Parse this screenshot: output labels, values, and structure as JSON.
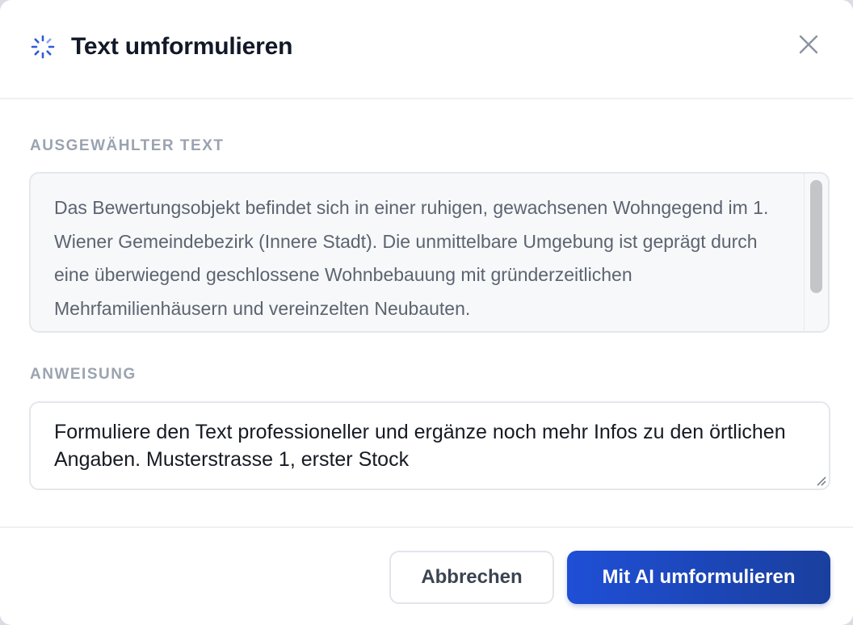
{
  "dialog": {
    "title": "Text umformulieren",
    "icon": "spinner-icon",
    "close_icon": "close-icon"
  },
  "selected_text": {
    "label": "AUSGEWÄHLTER TEXT",
    "content": "Das Bewertungsobjekt befindet sich in einer ruhigen, gewachsenen Wohngegend im 1. Wiener Gemeindebezirk (Innere Stadt). Die unmittelbare Umgebung ist geprägt durch eine überwiegend geschlossene Wohnbebauung mit gründerzeitlichen Mehrfamilienhäusern und vereinzelten Neubauten."
  },
  "instruction": {
    "label": "ANWEISUNG",
    "value": "Formuliere den Text professioneller und ergänze noch mehr Infos zu den örtlichen Angaben. Musterstrasse 1, erster Stock"
  },
  "footer": {
    "cancel_label": "Abbrechen",
    "submit_label": "Mit AI umformulieren"
  },
  "colors": {
    "primary": "#1f4fd6",
    "primary_dark": "#1a3f9e",
    "label_gray": "#9aa3b0",
    "title": "#111827"
  }
}
